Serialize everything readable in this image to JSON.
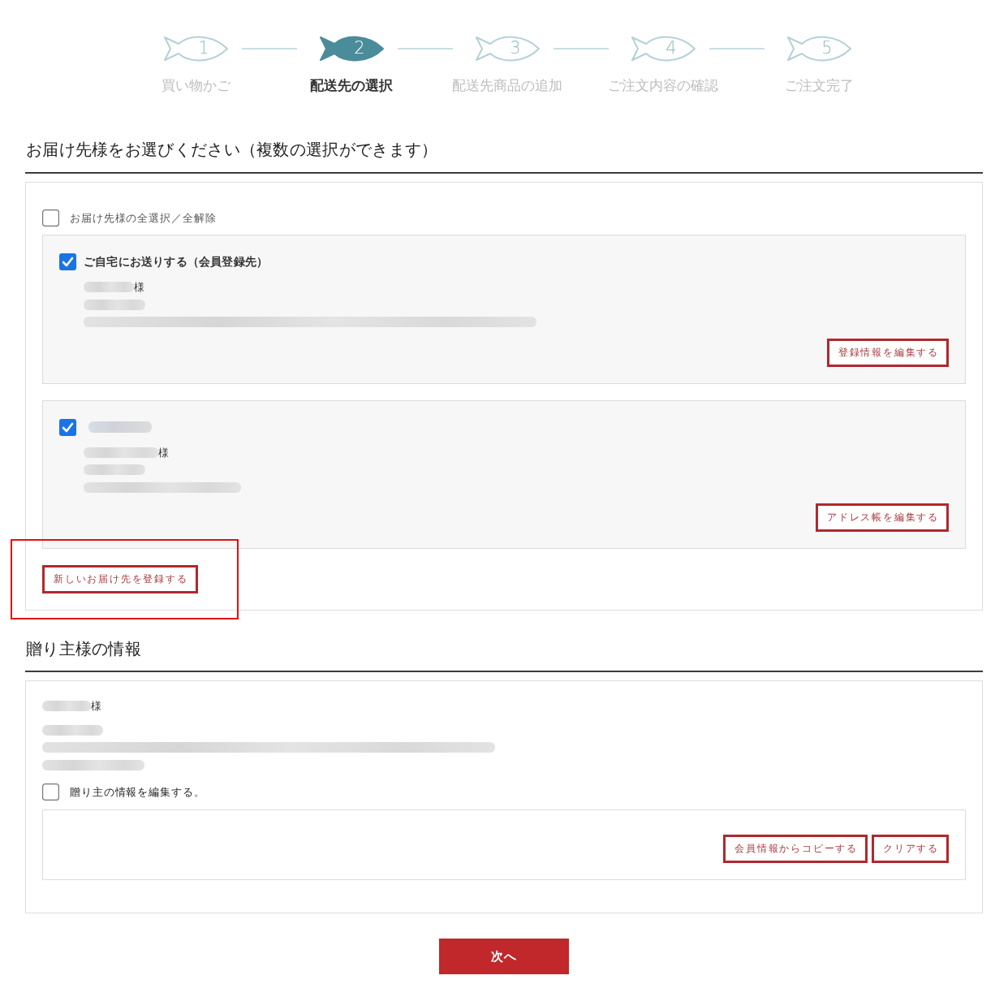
{
  "steps": [
    {
      "number": "1",
      "label": "買い物かご",
      "selected": false
    },
    {
      "number": "2",
      "label": "配送先の選択",
      "selected": true
    },
    {
      "number": "3",
      "label": "配送先商品の追加",
      "selected": false
    },
    {
      "number": "4",
      "label": "ご注文内容の確認",
      "selected": false
    },
    {
      "number": "5",
      "label": "ご注文完了",
      "selected": false
    }
  ],
  "recipients": {
    "title": "お届け先様をお選びください（複数の選択ができます）",
    "select_all": {
      "label": "お届け先様の全選択／全解除",
      "checked": false
    },
    "addresses": [
      {
        "checked": true,
        "heading": {
          "kind": "text",
          "text": "ご自宅にお送りする（会員登録先）"
        },
        "lines": [
          {
            "kind": "blurred",
            "suffix": "様"
          },
          {
            "kind": "blurred"
          },
          {
            "kind": "blurred"
          }
        ],
        "button": "登録情報を編集する"
      },
      {
        "checked": true,
        "heading": {
          "kind": "blurred"
        },
        "lines": [
          {
            "kind": "blurred",
            "suffix": "様"
          },
          {
            "kind": "blurred"
          },
          {
            "kind": "blurred"
          }
        ],
        "button": "アドレス帳を編集する"
      }
    ],
    "add_button": {
      "label": "新しいお届け先を登録する",
      "annotated": true
    }
  },
  "sender": {
    "title": "贈り主様の情報",
    "lines": [
      {
        "kind": "blurred",
        "suffix": "様"
      },
      {
        "kind": "blurred"
      },
      {
        "kind": "blurred"
      },
      {
        "kind": "blurred"
      }
    ],
    "edit": {
      "label": "贈り主の情報を編集する。",
      "checked": false
    },
    "buttons": [
      "会員情報からコピーする",
      "クリアする"
    ]
  },
  "next_button": "次へ"
}
